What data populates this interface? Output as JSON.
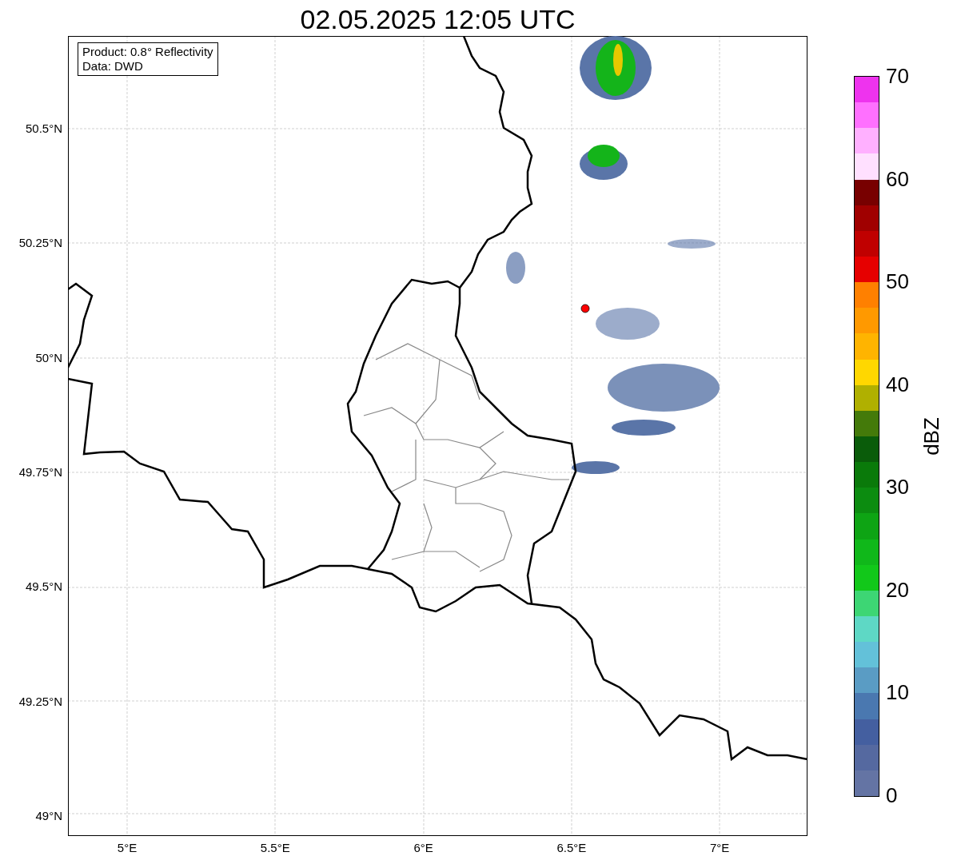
{
  "title": "02.05.2025 12:05 UTC",
  "info_box": {
    "lines": [
      "Product: 0.8° Reflectivity",
      "Data: DWD"
    ]
  },
  "y_ticks": [
    "50.5°N",
    "50.25°N",
    "50°N",
    "49.75°N",
    "49.5°N",
    "49.25°N",
    "49°N"
  ],
  "x_ticks": [
    "5°E",
    "5.5°E",
    "6°E",
    "6.5°E",
    "7°E"
  ],
  "colorbar": {
    "ticks": [
      "70",
      "60",
      "50",
      "40",
      "30",
      "20",
      "10",
      "0"
    ],
    "label": "dBZ",
    "bands": [
      {
        "color": "#ee33ee"
      },
      {
        "color": "#ff70ff"
      },
      {
        "color": "#ffb0ff"
      },
      {
        "color": "#ffe0ff"
      },
      {
        "color": "#780000"
      },
      {
        "color": "#a00000"
      },
      {
        "color": "#c00000"
      },
      {
        "color": "#e60000"
      },
      {
        "color": "#ff8000"
      },
      {
        "color": "#ff9900"
      },
      {
        "color": "#ffb400"
      },
      {
        "color": "#ffd700"
      },
      {
        "color": "#b0b000"
      },
      {
        "color": "#447a0a"
      },
      {
        "color": "#0a5c0a"
      },
      {
        "color": "#0a7a0a"
      },
      {
        "color": "#0c8c10"
      },
      {
        "color": "#0ea414"
      },
      {
        "color": "#10b81a"
      },
      {
        "color": "#12c81a"
      },
      {
        "color": "#3dd674"
      },
      {
        "color": "#5ed8c5"
      },
      {
        "color": "#63c1d9"
      },
      {
        "color": "#5a9cc4"
      },
      {
        "color": "#4a78b0"
      },
      {
        "color": "#445fa0"
      },
      {
        "color": "#5569a0"
      },
      {
        "color": "#6474a4"
      }
    ]
  }
}
